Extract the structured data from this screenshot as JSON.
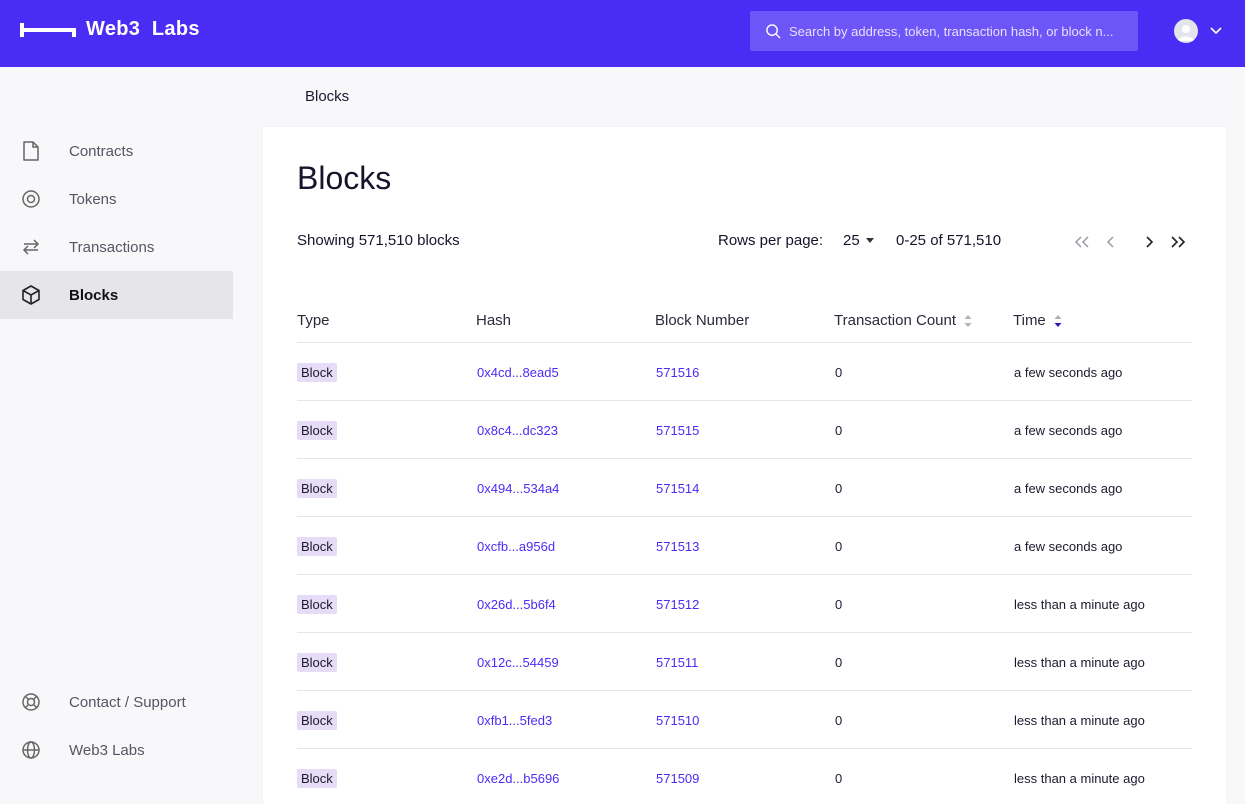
{
  "header": {
    "brand": "Web3  Labs",
    "search_placeholder": "Search by address, token, transaction hash, or block n..."
  },
  "sidebar": {
    "items": [
      {
        "label": "Contracts",
        "icon": "file-icon"
      },
      {
        "label": "Tokens",
        "icon": "token-icon"
      },
      {
        "label": "Transactions",
        "icon": "transactions-icon"
      },
      {
        "label": "Blocks",
        "icon": "cube-icon",
        "active": true
      }
    ],
    "footer_items": [
      {
        "label": "Contact / Support",
        "icon": "lifebuoy-icon"
      },
      {
        "label": "Web3 Labs",
        "icon": "globe-icon"
      }
    ]
  },
  "breadcrumb": "Blocks",
  "main": {
    "title": "Blocks",
    "showing": "Showing 571,510 blocks",
    "rows_per_page_label": "Rows per page:",
    "rows_per_page": "25",
    "range": "0-25 of 571,510"
  },
  "table": {
    "columns": [
      "Type",
      "Hash",
      "Block Number",
      "Transaction Count",
      "Time"
    ],
    "rows": [
      {
        "type": "Block",
        "hash": "0x4cd...8ead5",
        "block": "571516",
        "count": "0",
        "time": "a few seconds ago"
      },
      {
        "type": "Block",
        "hash": "0x8c4...dc323",
        "block": "571515",
        "count": "0",
        "time": "a few seconds ago"
      },
      {
        "type": "Block",
        "hash": "0x494...534a4",
        "block": "571514",
        "count": "0",
        "time": "a few seconds ago"
      },
      {
        "type": "Block",
        "hash": "0xcfb...a956d",
        "block": "571513",
        "count": "0",
        "time": "a few seconds ago"
      },
      {
        "type": "Block",
        "hash": "0x26d...5b6f4",
        "block": "571512",
        "count": "0",
        "time": "less than a minute ago"
      },
      {
        "type": "Block",
        "hash": "0x12c...54459",
        "block": "571511",
        "count": "0",
        "time": "less than a minute ago"
      },
      {
        "type": "Block",
        "hash": "0xfb1...5fed3",
        "block": "571510",
        "count": "0",
        "time": "less than a minute ago"
      },
      {
        "type": "Block",
        "hash": "0xe2d...b5696",
        "block": "571509",
        "count": "0",
        "time": "less than a minute ago"
      }
    ]
  },
  "colors": {
    "brand": "#4b2cf5",
    "search_bg": "#6e55f7",
    "badge_bg": "#e6dcf7",
    "link": "#4b2cf5"
  }
}
